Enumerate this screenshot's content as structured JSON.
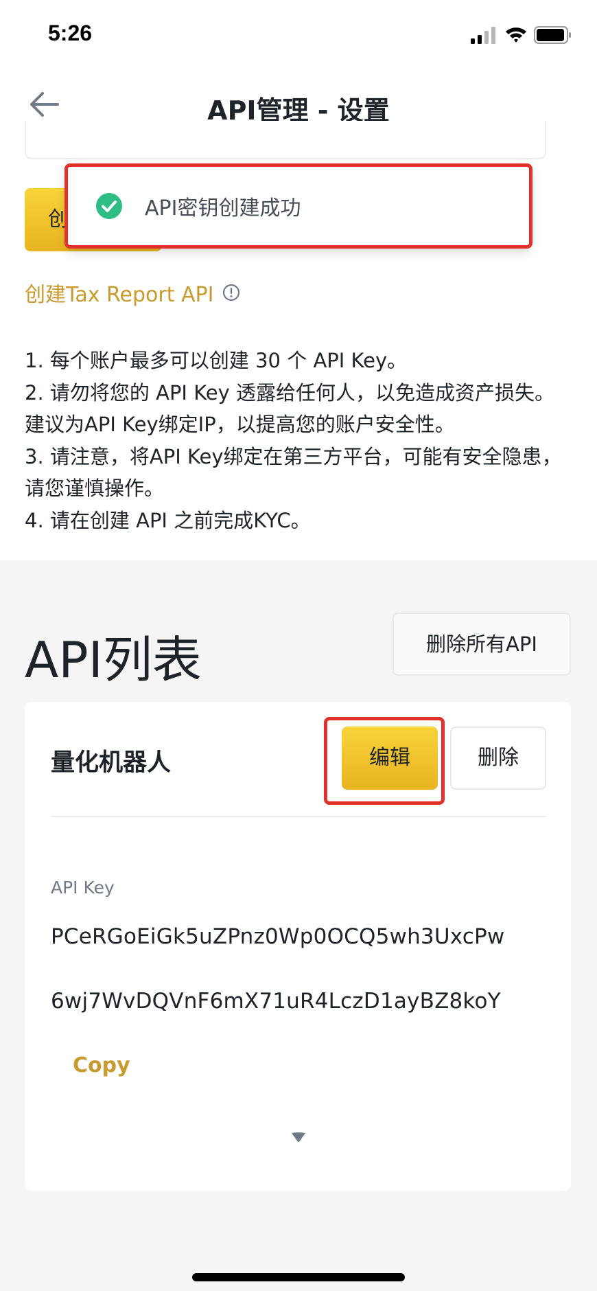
{
  "status_bar": {
    "time": "5:26",
    "icons": [
      "signal-icon",
      "wifi-icon",
      "battery-icon"
    ]
  },
  "header": {
    "title": "API管理 - 设置",
    "back_icon": "back-arrow-icon"
  },
  "create_button": {
    "label": "创"
  },
  "toast": {
    "message": "API密钥创建成功",
    "icon": "check-circle-icon",
    "highlight_color": "#e0322a"
  },
  "tax_link": {
    "label": "创建Tax Report API",
    "icon": "info-icon"
  },
  "notes": [
    "1. 每个账户最多可以创建 30 个 API Key。",
    "2. 请勿将您的 API Key 透露给任何人，以免造成资产损失。建议为API Key绑定IP，以提高您的账户安全性。",
    "3. 请注意，将API Key绑定在第三方平台，可能有安全隐患，请您谨慎操作。",
    "4. 请在创建 API 之前完成KYC。"
  ],
  "api_list": {
    "title": "API列表",
    "delete_all_label": "删除所有API",
    "items": [
      {
        "name": "量化机器人",
        "edit_label": "编辑",
        "delete_label": "删除",
        "api_key_label": "API Key",
        "api_key_line1": "PCeRGoEiGk5uZPnz0Wp0OCQ5wh3UxcPw",
        "api_key_line2": "6wj7WvDQVnF6mX71uR4LczD1ayBZ8koY",
        "copy_label": "Copy",
        "expand_icon": "caret-down-icon"
      }
    ]
  },
  "colors": {
    "accent_yellow": "#f0b90b",
    "link_gold": "#c99a2e",
    "success_green": "#2ebd85",
    "highlight_red": "#e0322a",
    "section_bg": "#f5f5f5"
  }
}
